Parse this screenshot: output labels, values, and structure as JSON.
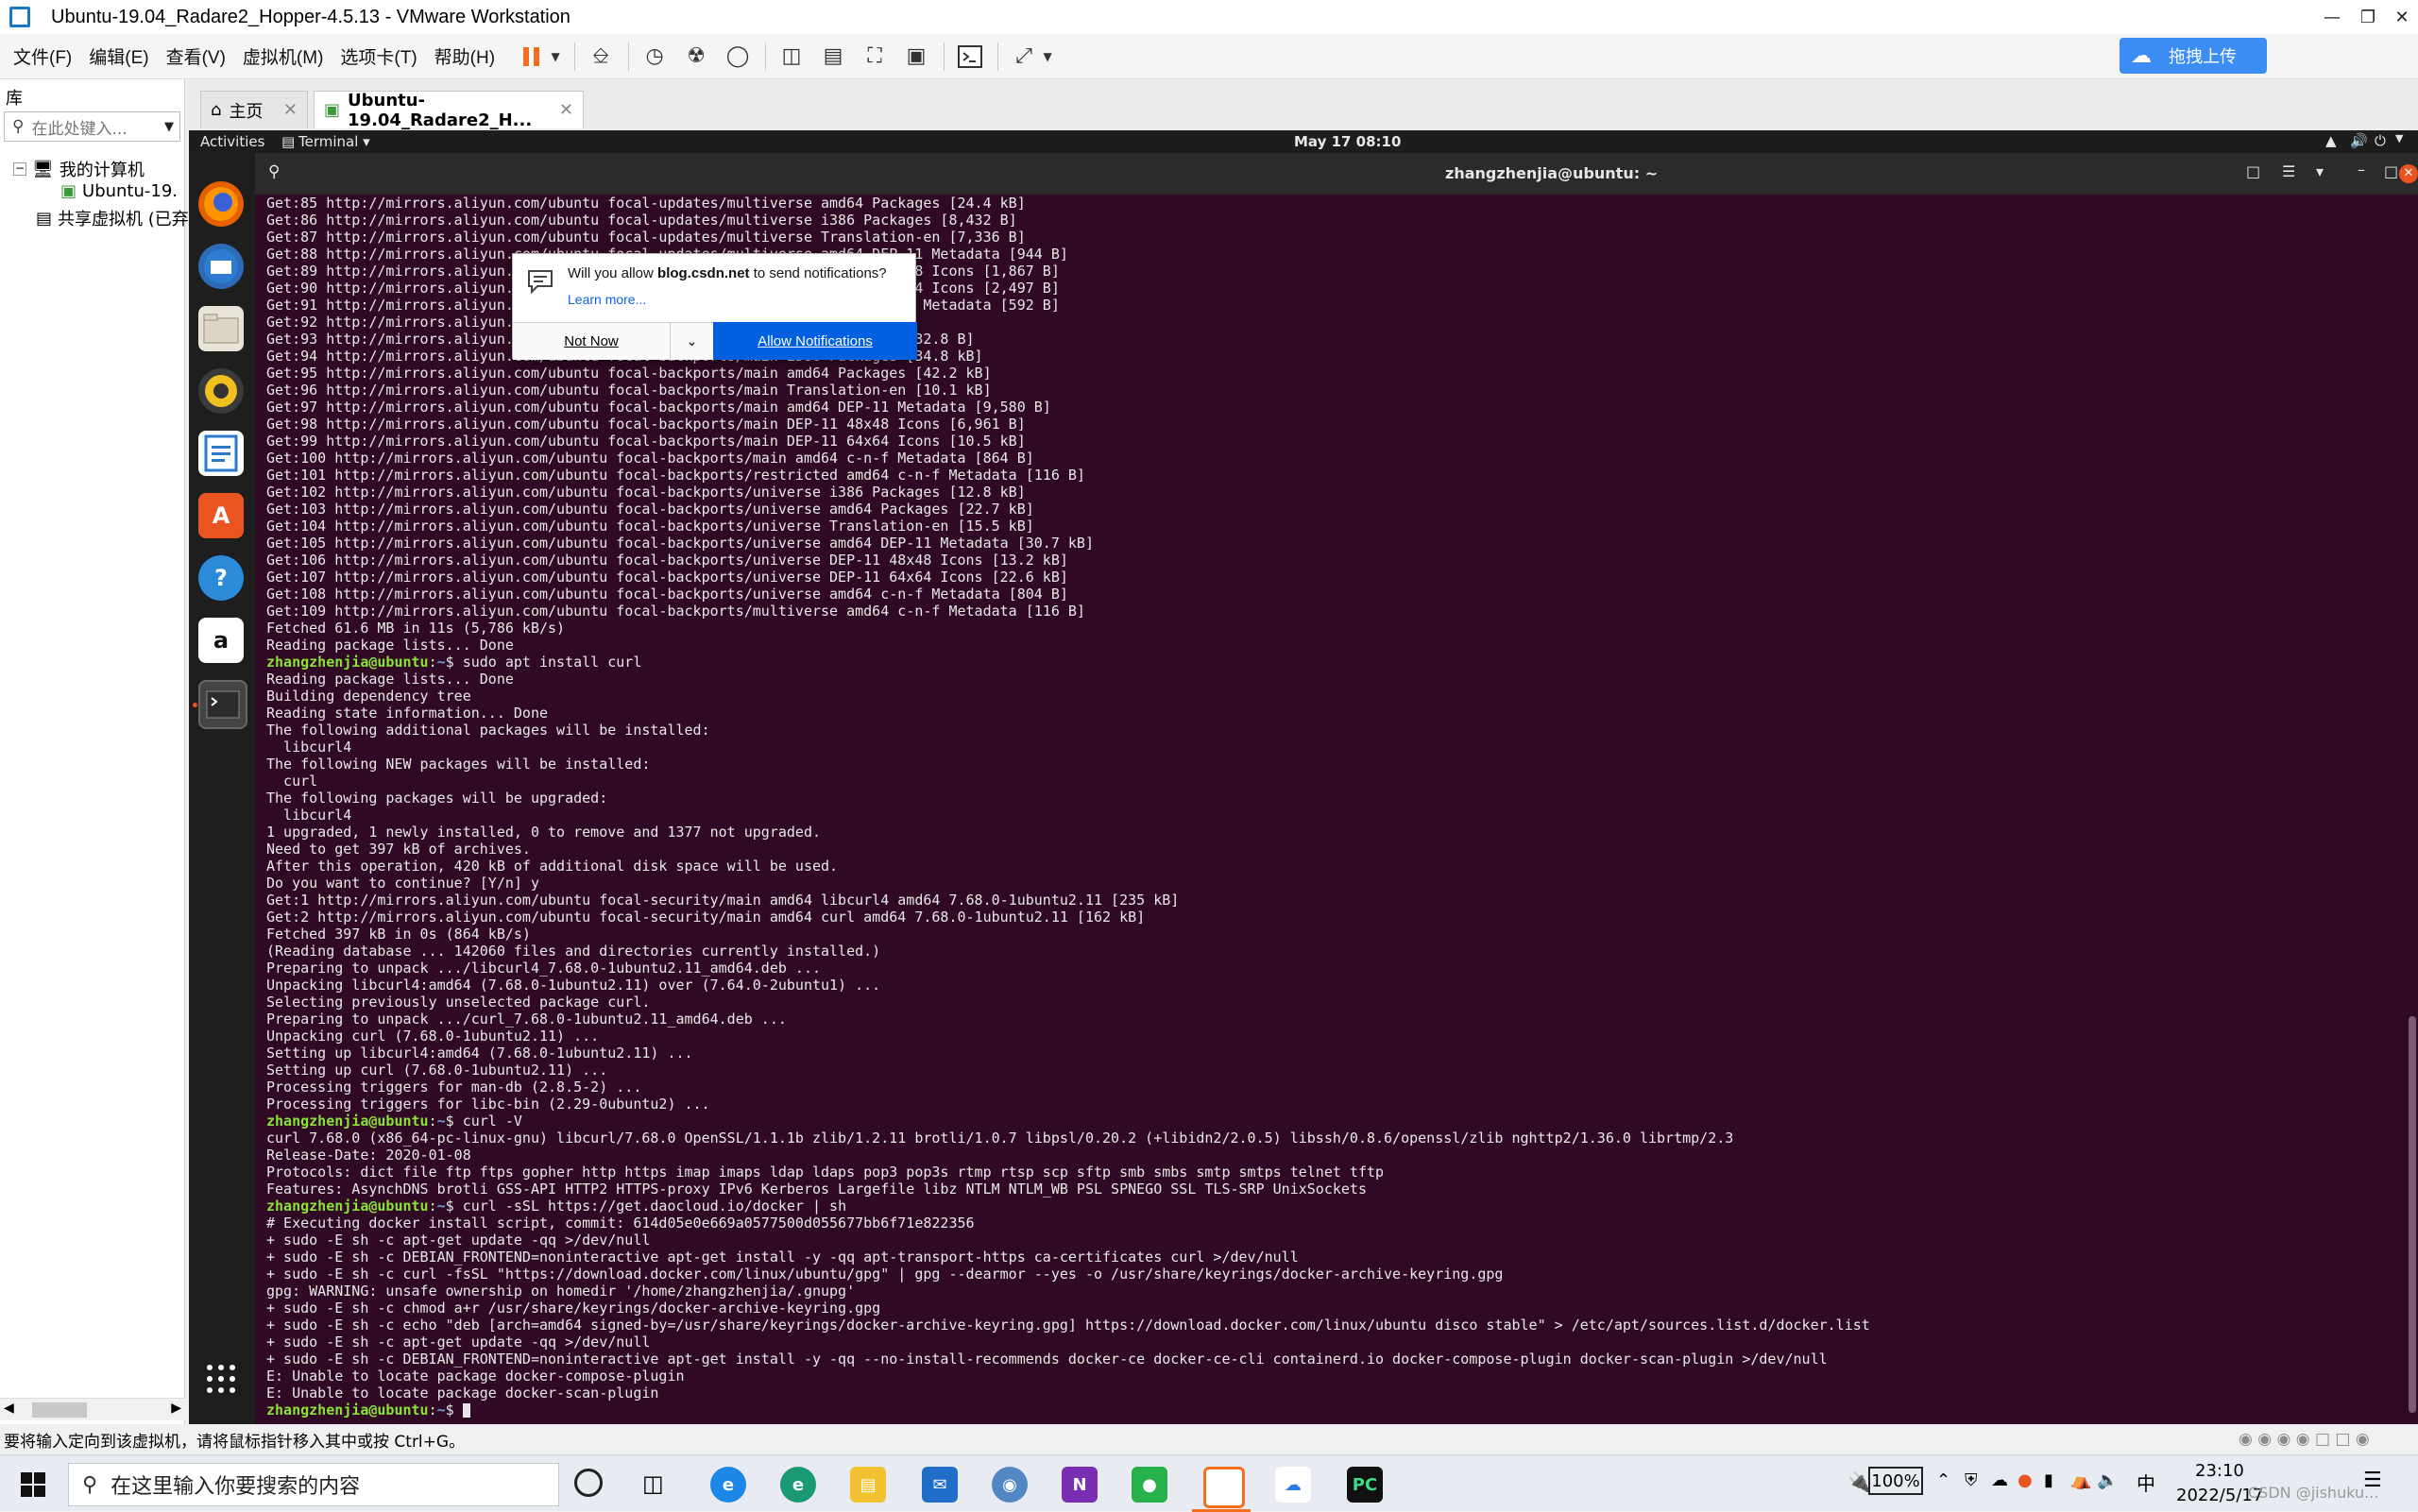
{
  "window": {
    "title": "Ubuntu-19.04_Radare2_Hopper-4.5.13 - VMware Workstation"
  },
  "menu": {
    "items": [
      "文件(F)",
      "编辑(E)",
      "查看(V)",
      "虚拟机(M)",
      "选项卡(T)",
      "帮助(H)"
    ]
  },
  "upload_button": {
    "label": "拖拽上传"
  },
  "library": {
    "header": "库",
    "search_placeholder": "在此处键入...",
    "tree": [
      "我的计算机",
      "Ubuntu-19.",
      "共享虚拟机 (已弃"
    ]
  },
  "tabs": [
    {
      "label": "主页"
    },
    {
      "label": "Ubuntu-19.04_Radare2_H..."
    }
  ],
  "gnome": {
    "activities": "Activities",
    "app_menu": "Terminal ▾",
    "clock": "May 17  08:10"
  },
  "terminal": {
    "title": "zhangzhenjia@ubuntu: ~",
    "prompt_user": "zhangzhenjia@ubuntu",
    "prompt_path": "~",
    "lines": [
      "Get:85 http://mirrors.aliyun.com/ubuntu focal-updates/multiverse amd64 Packages [24.4 kB]",
      "Get:86 http://mirrors.aliyun.com/ubuntu focal-updates/multiverse i386 Packages [8,432 B]",
      "Get:87 http://mirrors.aliyun.com/ubuntu focal-updates/multiverse Translation-en [7,336 B]",
      "Get:88 http://mirrors.aliyun.com/ubuntu focal-updates/multiverse amd64 DEP-11 Metadata [944 B]",
      "Get:89 http://mirrors.aliyun.com/ubuntu focal-updates/multiverse DEP-11 48x48 Icons [1,867 B]",
      "Get:90 http://mirrors.aliyun.com/ubuntu focal-updates/multiverse DEP-11 64x64 Icons [2,497 B]",
      "Get:91 http://mirrors.aliyun.com/ubuntu focal-updates/multiverse amd64 c-n-f Metadata [592 B]",
      "Get:92 http://mirrors.aliyun.com/ubuntu focal-backports/main i386 Packages",
      "Get:93 http://mirrors.aliyun.com/ubuntu focal-backports/main i386 Packages [32.8 B]",
      "Get:94 http://mirrors.aliyun.com/ubuntu focal-backports/main i386 Packages [34.8 kB]",
      "Get:95 http://mirrors.aliyun.com/ubuntu focal-backports/main amd64 Packages [42.2 kB]",
      "Get:96 http://mirrors.aliyun.com/ubuntu focal-backports/main Translation-en [10.1 kB]",
      "Get:97 http://mirrors.aliyun.com/ubuntu focal-backports/main amd64 DEP-11 Metadata [9,580 B]",
      "Get:98 http://mirrors.aliyun.com/ubuntu focal-backports/main DEP-11 48x48 Icons [6,961 B]",
      "Get:99 http://mirrors.aliyun.com/ubuntu focal-backports/main DEP-11 64x64 Icons [10.5 kB]",
      "Get:100 http://mirrors.aliyun.com/ubuntu focal-backports/main amd64 c-n-f Metadata [864 B]",
      "Get:101 http://mirrors.aliyun.com/ubuntu focal-backports/restricted amd64 c-n-f Metadata [116 B]",
      "Get:102 http://mirrors.aliyun.com/ubuntu focal-backports/universe i386 Packages [12.8 kB]",
      "Get:103 http://mirrors.aliyun.com/ubuntu focal-backports/universe amd64 Packages [22.7 kB]",
      "Get:104 http://mirrors.aliyun.com/ubuntu focal-backports/universe Translation-en [15.5 kB]",
      "Get:105 http://mirrors.aliyun.com/ubuntu focal-backports/universe amd64 DEP-11 Metadata [30.7 kB]",
      "Get:106 http://mirrors.aliyun.com/ubuntu focal-backports/universe DEP-11 48x48 Icons [13.2 kB]",
      "Get:107 http://mirrors.aliyun.com/ubuntu focal-backports/universe DEP-11 64x64 Icons [22.6 kB]",
      "Get:108 http://mirrors.aliyun.com/ubuntu focal-backports/universe amd64 c-n-f Metadata [804 B]",
      "Get:109 http://mirrors.aliyun.com/ubuntu focal-backports/multiverse amd64 c-n-f Metadata [116 B]",
      "Fetched 61.6 MB in 11s (5,786 kB/s)",
      "Reading package lists... Done",
      "$ sudo apt install curl",
      "Reading package lists... Done",
      "Building dependency tree",
      "Reading state information... Done",
      "The following additional packages will be installed:",
      "  libcurl4",
      "The following NEW packages will be installed:",
      "  curl",
      "The following packages will be upgraded:",
      "  libcurl4",
      "1 upgraded, 1 newly installed, 0 to remove and 1377 not upgraded.",
      "Need to get 397 kB of archives.",
      "After this operation, 420 kB of additional disk space will be used.",
      "Do you want to continue? [Y/n] y",
      "Get:1 http://mirrors.aliyun.com/ubuntu focal-security/main amd64 libcurl4 amd64 7.68.0-1ubuntu2.11 [235 kB]",
      "Get:2 http://mirrors.aliyun.com/ubuntu focal-security/main amd64 curl amd64 7.68.0-1ubuntu2.11 [162 kB]",
      "Fetched 397 kB in 0s (864 kB/s)",
      "(Reading database ... 142060 files and directories currently installed.)",
      "Preparing to unpack .../libcurl4_7.68.0-1ubuntu2.11_amd64.deb ...",
      "Unpacking libcurl4:amd64 (7.68.0-1ubuntu2.11) over (7.64.0-2ubuntu1) ...",
      "Selecting previously unselected package curl.",
      "Preparing to unpack .../curl_7.68.0-1ubuntu2.11_amd64.deb ...",
      "Unpacking curl (7.68.0-1ubuntu2.11) ...",
      "Setting up libcurl4:amd64 (7.68.0-1ubuntu2.11) ...",
      "Setting up curl (7.68.0-1ubuntu2.11) ...",
      "Processing triggers for man-db (2.8.5-2) ...",
      "Processing triggers for libc-bin (2.29-0ubuntu2) ...",
      "$ curl -V",
      "curl 7.68.0 (x86_64-pc-linux-gnu) libcurl/7.68.0 OpenSSL/1.1.1b zlib/1.2.11 brotli/1.0.7 libpsl/0.20.2 (+libidn2/2.0.5) libssh/0.8.6/openssl/zlib nghttp2/1.36.0 librtmp/2.3",
      "Release-Date: 2020-01-08",
      "Protocols: dict file ftp ftps gopher http https imap imaps ldap ldaps pop3 pop3s rtmp rtsp scp sftp smb smbs smtp smtps telnet tftp",
      "Features: AsynchDNS brotli GSS-API HTTP2 HTTPS-proxy IPv6 Kerberos Largefile libz NTLM NTLM_WB PSL SPNEGO SSL TLS-SRP UnixSockets",
      "$ curl -sSL https://get.daocloud.io/docker | sh",
      "# Executing docker install script, commit: 614d05e0e669a0577500d055677bb6f71e822356",
      "+ sudo -E sh -c apt-get update -qq >/dev/null",
      "+ sudo -E sh -c DEBIAN_FRONTEND=noninteractive apt-get install -y -qq apt-transport-https ca-certificates curl >/dev/null",
      "+ sudo -E sh -c curl -fsSL \"https://download.docker.com/linux/ubuntu/gpg\" | gpg --dearmor --yes -o /usr/share/keyrings/docker-archive-keyring.gpg",
      "gpg: WARNING: unsafe ownership on homedir '/home/zhangzhenjia/.gnupg'",
      "+ sudo -E sh -c chmod a+r /usr/share/keyrings/docker-archive-keyring.gpg",
      "+ sudo -E sh -c echo \"deb [arch=amd64 signed-by=/usr/share/keyrings/docker-archive-keyring.gpg] https://download.docker.com/linux/ubuntu disco stable\" > /etc/apt/sources.list.d/docker.list",
      "+ sudo -E sh -c apt-get update -qq >/dev/null",
      "+ sudo -E sh -c DEBIAN_FRONTEND=noninteractive apt-get install -y -qq --no-install-recommends docker-ce docker-ce-cli containerd.io docker-compose-plugin docker-scan-plugin >/dev/null",
      "E: Unable to locate package docker-compose-plugin",
      "E: Unable to locate package docker-scan-plugin",
      "$ "
    ]
  },
  "notification": {
    "prefix": "Will you allow ",
    "site": "blog.csdn.net",
    "suffix": " to send notifications?",
    "learn_more": "Learn more...",
    "not_now": "Not Now",
    "allow": "Allow Notifications"
  },
  "statusbar": {
    "text": "要将输入定向到该虚拟机，请将鼠标指针移入其中或按 Ctrl+G。"
  },
  "taskbar": {
    "search_placeholder": "在这里输入你要搜索的内容",
    "battery": "100%",
    "ime": "中",
    "time": "23:10",
    "date": "2022/5/17",
    "watermark": "CSDN @jishuku..."
  },
  "colors": {
    "terminal_bg": "#300a24",
    "prompt_user": "#8ae234",
    "prompt_path": "#729fcf",
    "accent_blue": "#0060df"
  }
}
